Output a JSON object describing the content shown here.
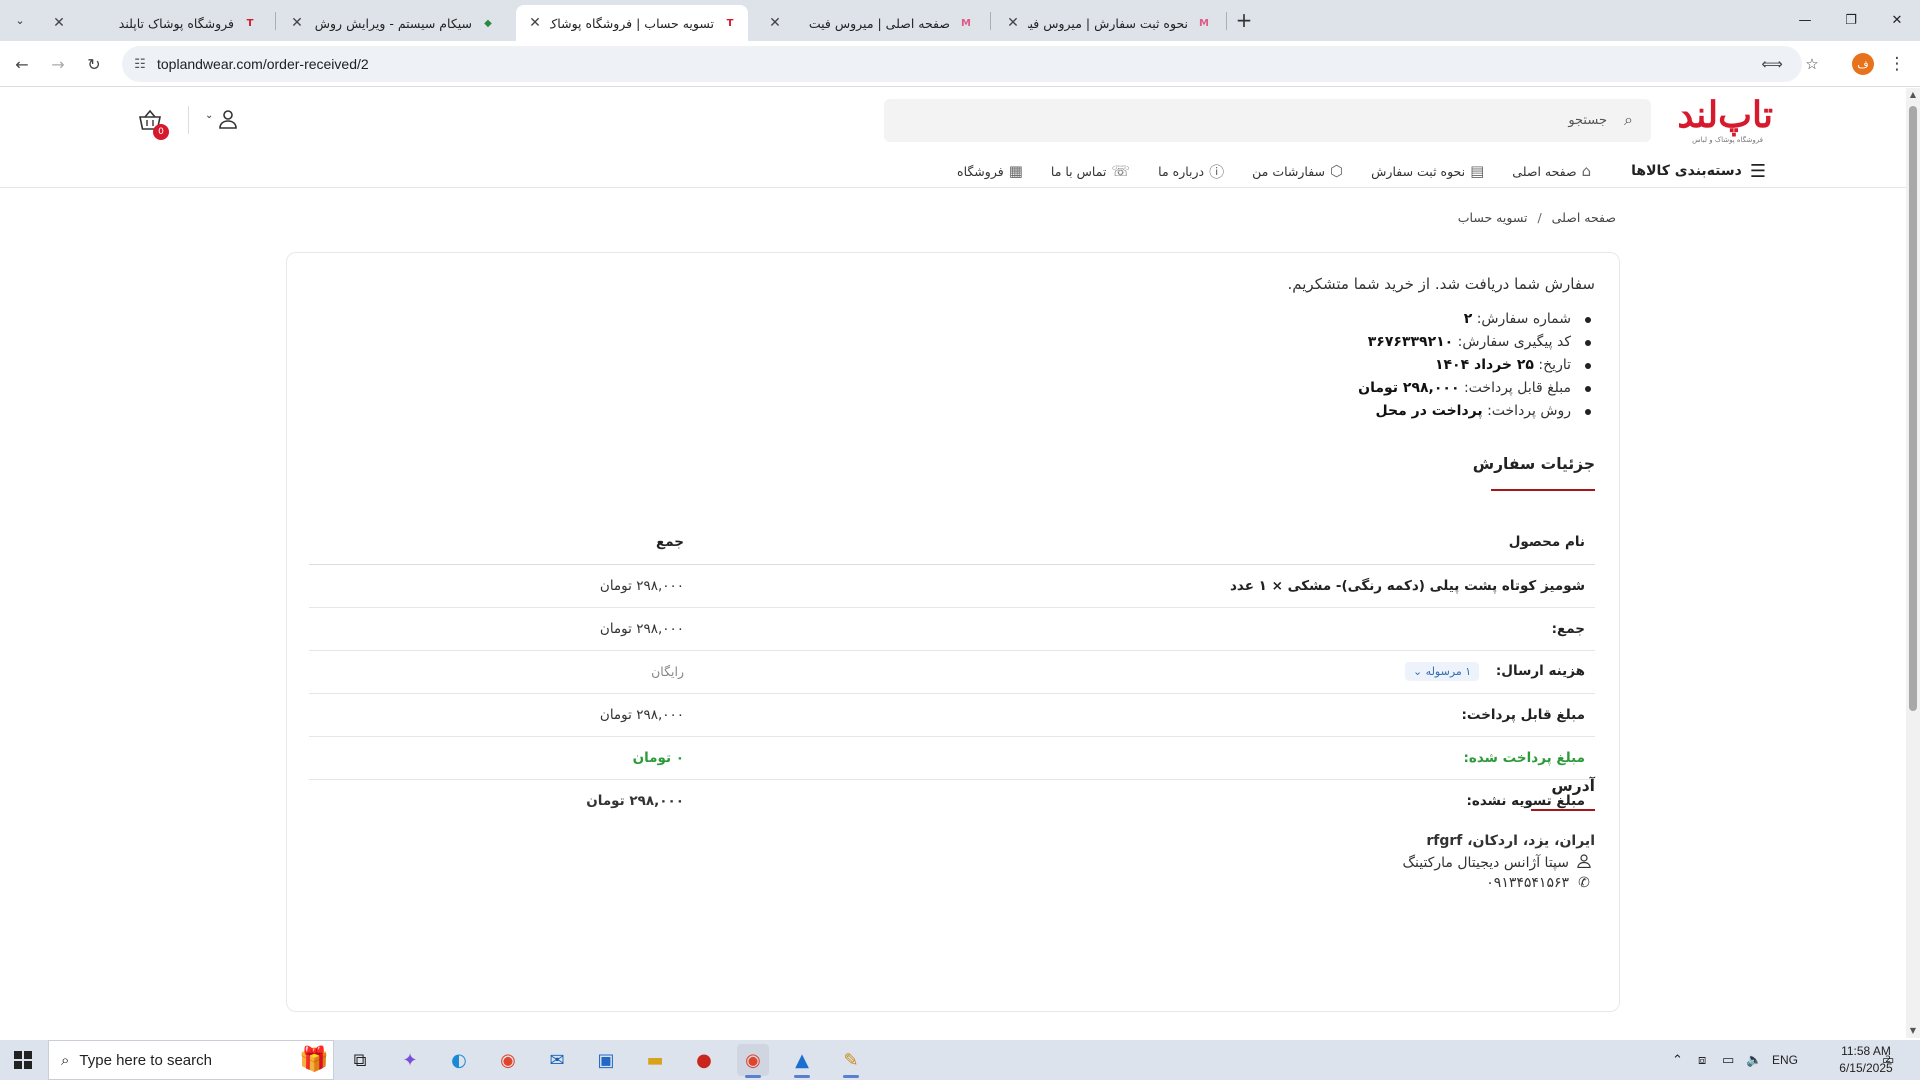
{
  "browser": {
    "tabs": [
      {
        "title": "فروشگاه پوشاک تاپلند",
        "favicon": "T",
        "fav_color": "#d7192d"
      },
      {
        "title": "سیکام سیستم - ویرایش روش پرداخت",
        "favicon": "◆",
        "fav_color": "#2b8a3e"
      },
      {
        "title": "تسویه حساب | فروشگاه پوشاک تاپلند",
        "favicon": "T",
        "fav_color": "#d7192d",
        "active": true
      },
      {
        "title": "صفحه اصلی | میروس فیت",
        "favicon": "M",
        "fav_color": "#e05a87"
      },
      {
        "title": "نحوه ثبت سفارش | میروس فیت",
        "favicon": "M",
        "fav_color": "#e05a87"
      }
    ],
    "url": "toplandwear.com/order-received/2",
    "profile_initial": "ف"
  },
  "header": {
    "logo_text": "تاپ‌لند",
    "logo_tagline": "فروشگاه پوشاک و لباس",
    "search_placeholder": "جستجو",
    "cart_count": "0"
  },
  "menu": {
    "categories": "دسته‌بندی کالاها",
    "items": [
      {
        "label": "صفحه اصلی",
        "icon": "home-icon"
      },
      {
        "label": "نحوه ثبت سفارش",
        "icon": "receipt-icon"
      },
      {
        "label": "سفارشات من",
        "icon": "box-icon"
      },
      {
        "label": "درباره ما",
        "icon": "info-icon"
      },
      {
        "label": "تماس با ما",
        "icon": "handshake-icon"
      },
      {
        "label": "فروشگاه",
        "icon": "store-icon"
      }
    ]
  },
  "breadcrumb": {
    "home": "صفحه اصلی",
    "separator": "/",
    "current": "تسویه حساب"
  },
  "order": {
    "thanks": "سفارش شما دریافت شد. از خرید شما متشکریم.",
    "overview": [
      {
        "label": "شماره سفارش:",
        "value": "۲"
      },
      {
        "label": "کد پیگیری سفارش:",
        "value": "۳۶۷۶۳۳۹۲۱۰"
      },
      {
        "label": "تاریخ:",
        "value": "۲۵ خرداد ۱۴۰۴"
      },
      {
        "label": "مبلغ قابل پرداخت:",
        "value": "۲۹۸,۰۰۰ تومان"
      },
      {
        "label": "روش پرداخت:",
        "value": "پرداخت در محل"
      }
    ],
    "details_title": "جزئیات سفارش",
    "table_headers": {
      "product": "نام محصول",
      "total": "جمع"
    },
    "product_row": {
      "name": "شومیز کوتاه پشت پیلی (دکمه رنگی)- مشکی × ۱ عدد",
      "total": "۲۹۸,۰۰۰ تومان"
    },
    "subtotal": {
      "label": "جمع:",
      "value": "۲۹۸,۰۰۰ تومان"
    },
    "shipping": {
      "label": "هزینه ارسال:",
      "badge": "۱ مرسوله",
      "value": "رایگان"
    },
    "payable": {
      "label": "مبلغ قابل پرداخت:",
      "value": "۲۹۸,۰۰۰ تومان"
    },
    "paid": {
      "label": "مبلغ پرداخت شده:",
      "value": "۰ تومان"
    },
    "unsettled": {
      "label": "مبلغ تسویه نشده:",
      "value": "۲۹۸,۰۰۰ تومان"
    },
    "address_title": "آدرس",
    "address_line": "ایران، یزد، اردکان، rfgrf",
    "customer_name": "سپتا آژانس دیجیتال مارکتینگ",
    "phone": "۰۹۱۳۴۵۴۱۵۶۳"
  },
  "taskbar": {
    "search_placeholder": "Type here to search",
    "language": "ENG",
    "time": "11:58 AM",
    "date": "6/15/2025",
    "notifications": "2"
  },
  "colors": {
    "brand_red": "#d7192d",
    "section_underline": "#a4161a",
    "paid_green": "#2e9b3a"
  }
}
